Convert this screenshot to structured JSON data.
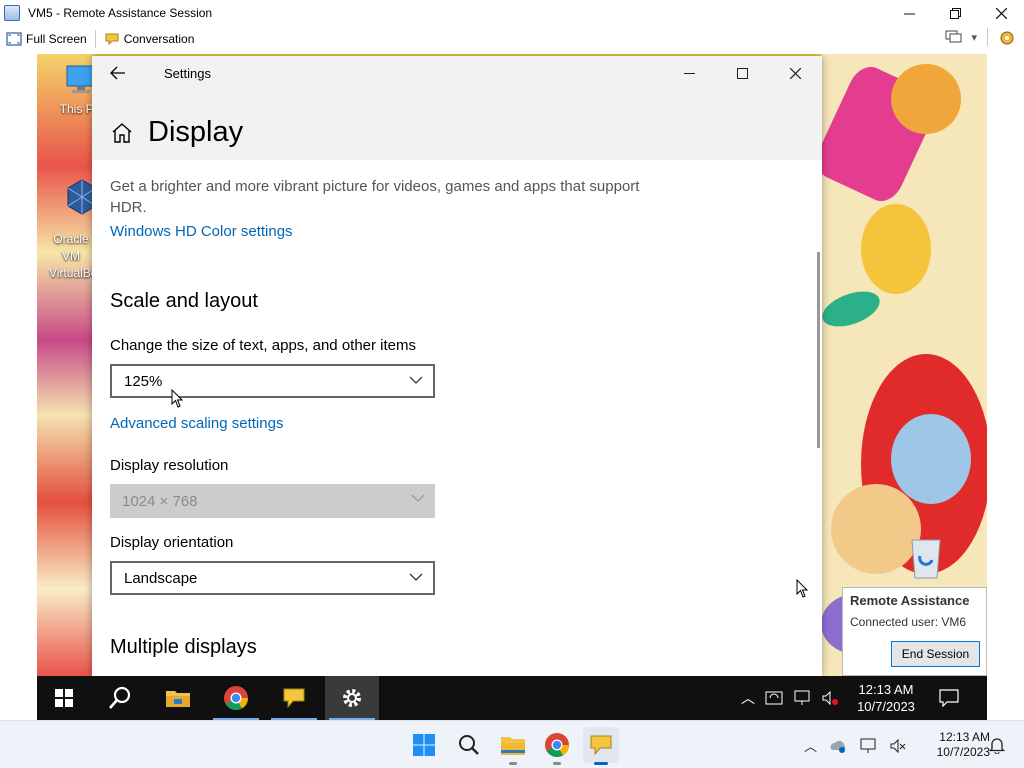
{
  "window": {
    "title": "VM5 - Remote Assistance Session"
  },
  "toolbar": {
    "fullscreen_label": "Full Screen",
    "conversation_label": "Conversation"
  },
  "desktop": {
    "icons": [
      {
        "label": "This PC",
        "icon": "computer-icon"
      },
      {
        "label": "Oracle VM VirtualBox",
        "icon": "virtualbox-icon"
      },
      {
        "label": "",
        "icon": "recycle-bin-icon"
      }
    ]
  },
  "settings": {
    "window_title": "Settings",
    "page_title": "Display",
    "hdr_description": "Get a brighter and more vibrant picture for videos, games and apps that support HDR.",
    "hdr_link": "Windows HD Color settings",
    "scale_heading": "Scale and layout",
    "scale_label": "Change the size of text, apps, and other items",
    "scale_value": "125%",
    "advanced_scaling_link": "Advanced scaling settings",
    "resolution_label": "Display resolution",
    "resolution_value": "1024 × 768",
    "orientation_label": "Display orientation",
    "orientation_value": "Landscape",
    "multiple_heading": "Multiple displays"
  },
  "ra_panel": {
    "title": "Remote Assistance",
    "connected": "Connected user: VM6",
    "end_button": "End Session"
  },
  "inner_taskbar": {
    "time": "12:13 AM",
    "date": "10/7/2023",
    "apps": [
      "start-icon",
      "search-icon",
      "file-explorer-icon",
      "chrome-icon",
      "remote-assistance-icon",
      "settings-icon"
    ]
  },
  "host_taskbar": {
    "time": "12:13 AM",
    "date": "10/7/2023",
    "apps": [
      "windows-start-icon",
      "search-icon",
      "file-explorer-icon",
      "chrome-icon",
      "remote-assistance-icon"
    ]
  },
  "colors": {
    "link": "#0067b8",
    "accent": "#0078d7"
  }
}
